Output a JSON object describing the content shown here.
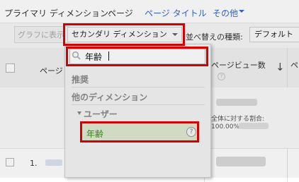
{
  "primary_dimension": {
    "label": "プライマリ ディメンション:",
    "current": "ページ",
    "alt_option": "ページ タイトル",
    "other_label": "その他"
  },
  "toolbar": {
    "graph_button": "グラフに表示",
    "secondary_dimension_button": "セカンダリ ディメンション",
    "sort_label": "並べ替えの種類:",
    "sort_value": "デフォルト"
  },
  "table": {
    "header_page": "ページ",
    "header_pageviews": "ページビュー数",
    "header_help": "?",
    "header_next": "ペ",
    "total_label": "全体に対する割合:",
    "total_value": "100.00% (",
    "row_index": "1."
  },
  "dropdown": {
    "search_value": "年齢",
    "section_recommended": "推奨",
    "section_other": "他のディメンション",
    "group_user": "ユーザー",
    "option_age": "年齢",
    "option_help": "?"
  },
  "colors": {
    "highlight": "#e00000",
    "link": "#3367d6",
    "selected_bg": "#dfe8cf",
    "selected_text": "#3b8a1f"
  },
  "icons": {
    "search": "search-icon",
    "sort_down": "arrow-down-icon",
    "caret": "caret-down-icon",
    "help": "help-circle-icon"
  }
}
